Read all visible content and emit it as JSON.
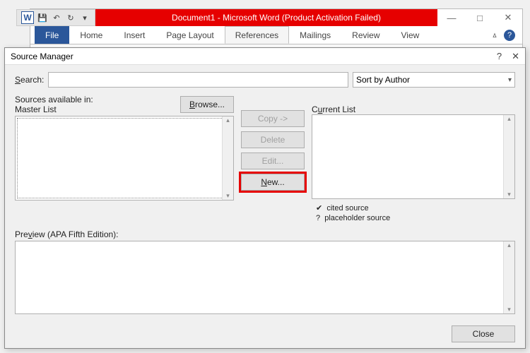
{
  "word": {
    "title": "Document1 - Microsoft Word (Product Activation Failed)",
    "tabs": {
      "file": "File",
      "home": "Home",
      "insert": "Insert",
      "page_layout": "Page Layout",
      "references": "References",
      "mailings": "Mailings",
      "review": "Review",
      "view": "View"
    }
  },
  "dialog": {
    "title": "Source Manager",
    "search_label": "Search:",
    "search_value": "",
    "sort_value": "Sort by Author",
    "sources_available_label": "Sources available in:",
    "master_list_label": "Master List",
    "current_list_label": "Current List",
    "browse": "Browse...",
    "copy": "Copy ->",
    "delete": "Delete",
    "edit": "Edit...",
    "new": "New...",
    "legend_cited": "cited source",
    "legend_placeholder": "placeholder source",
    "preview_label": "Preview (APA Fifth Edition):",
    "close": "Close"
  }
}
